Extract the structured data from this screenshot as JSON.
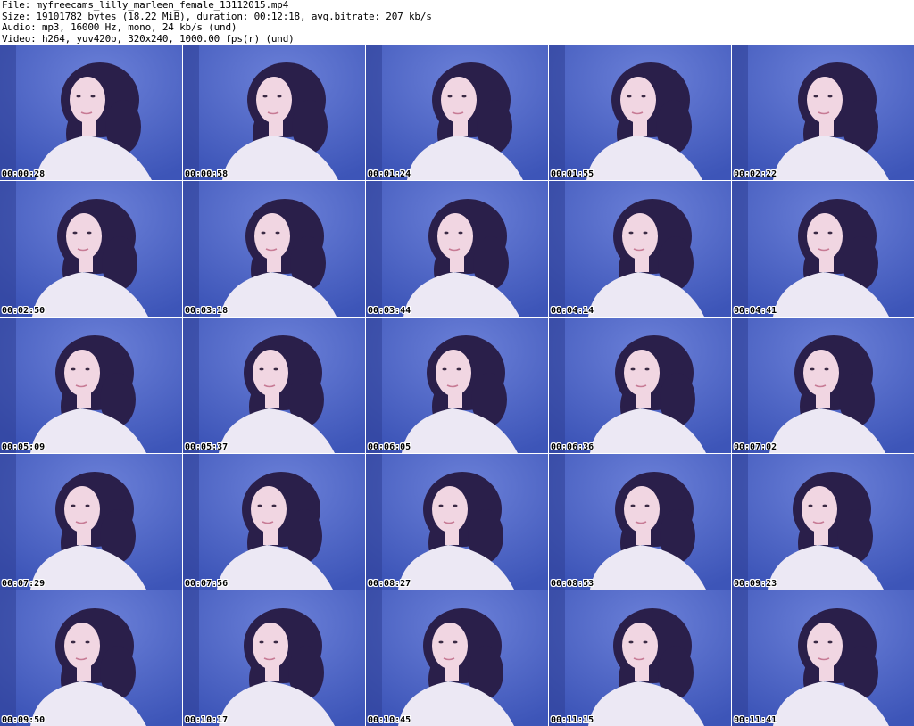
{
  "header": {
    "file_line": "File: myfreecams_lilly_marleen_female_13112015.mp4",
    "size_line": "Size: 19101782 bytes (18.22 MiB), duration: 00:12:18, avg.bitrate: 207 kb/s",
    "audio_line": "Audio: mp3, 16000 Hz, mono, 24 kb/s (und)",
    "video_line": "Video: h264, yuv420p, 320x240, 1000.00 fps(r) (und)"
  },
  "colors": {
    "background_blue": "#3d55b8",
    "hair": "#2a1f4a",
    "sweater": "#ece8f4",
    "skin": "#f1d6e2"
  },
  "thumbnails": [
    {
      "time": "00:00:28"
    },
    {
      "time": "00:00:58"
    },
    {
      "time": "00:01:24"
    },
    {
      "time": "00:01:55"
    },
    {
      "time": "00:02:22"
    },
    {
      "time": "00:02:50"
    },
    {
      "time": "00:03:18"
    },
    {
      "time": "00:03:44"
    },
    {
      "time": "00:04:14"
    },
    {
      "time": "00:04:41"
    },
    {
      "time": "00:05:09"
    },
    {
      "time": "00:05:37"
    },
    {
      "time": "00:06:05"
    },
    {
      "time": "00:06:36"
    },
    {
      "time": "00:07:02"
    },
    {
      "time": "00:07:29"
    },
    {
      "time": "00:07:56"
    },
    {
      "time": "00:08:27"
    },
    {
      "time": "00:08:53"
    },
    {
      "time": "00:09:23"
    },
    {
      "time": "00:09:50"
    },
    {
      "time": "00:10:17"
    },
    {
      "time": "00:10:45"
    },
    {
      "time": "00:11:15"
    },
    {
      "time": "00:11:41"
    }
  ]
}
